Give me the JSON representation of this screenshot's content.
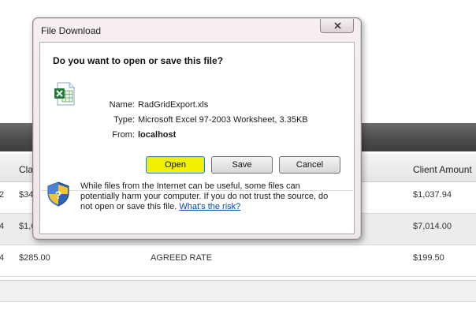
{
  "background": {
    "columns": [
      {
        "id": "claim",
        "label": "Clai"
      },
      {
        "id": "client_amount",
        "label": "Client Amount"
      }
    ],
    "rows": [
      {
        "left_edge": "2",
        "claim": "$34",
        "client_amount": "$1,037.94"
      },
      {
        "left_edge": "4",
        "claim": "$1,6",
        "client_amount": "$7,014.00"
      },
      {
        "left_edge": "4",
        "claim": "$285.00",
        "description": "AGREED RATE",
        "client_amount": "$199.50"
      }
    ]
  },
  "dialog": {
    "title": "File Download",
    "question": "Do you want to open or save this file?",
    "file": {
      "icon": "excel-file-icon",
      "name_label": "Name:",
      "name": "RadGridExport.xls",
      "type_label": "Type:",
      "type": "Microsoft Excel 97-2003 Worksheet, 3.35KB",
      "from_label": "From:",
      "from": "localhost"
    },
    "buttons": {
      "open": "Open",
      "save": "Save",
      "cancel": "Cancel"
    },
    "warning": {
      "text": "While files from the Internet can be useful, some files can potentially harm your computer. If you do not trust the source, do not open or save this file.",
      "link": "What's the risk?"
    },
    "colors": {
      "open_highlight": "#f2f200",
      "link": "#0645ad"
    }
  }
}
